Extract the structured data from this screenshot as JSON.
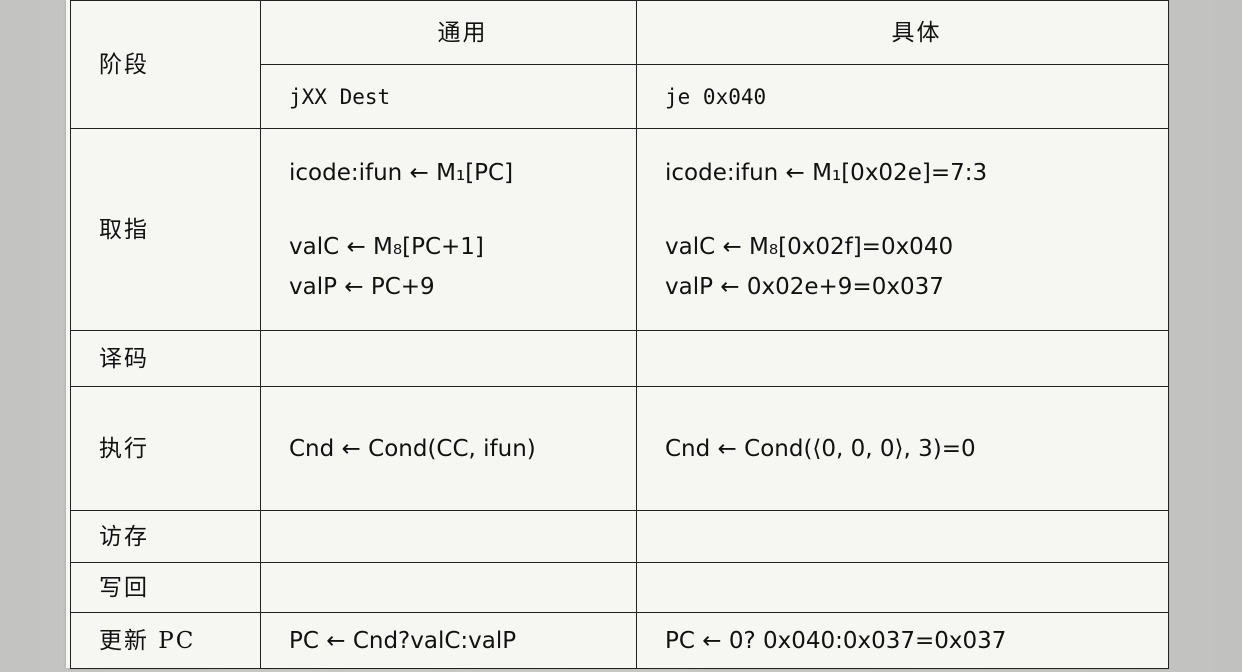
{
  "header": {
    "stage_label": "阶段",
    "general_label": "通用",
    "specific_label": "具体",
    "general_instr": "jXX Dest",
    "specific_instr": "je 0x040"
  },
  "rows": {
    "fetch": {
      "stage": "取指",
      "general": [
        "icode:ifun ← M₁[PC]",
        "valC ← M₈[PC+1]",
        "valP ← PC+9"
      ],
      "specific": [
        "icode:ifun ← M₁[0x02e]=7:3",
        "valC ← M₈[0x02f]=0x040",
        "valP ← 0x02e+9=0x037"
      ]
    },
    "decode": {
      "stage": "译码"
    },
    "execute": {
      "stage": "执行",
      "general": "Cnd ← Cond(CC, ifun)",
      "specific": "Cnd ← Cond(⟨0, 0, 0⟩, 3)=0"
    },
    "memory": {
      "stage": "访存"
    },
    "writeback": {
      "stage": "写回"
    },
    "update_pc": {
      "stage": "更新 PC",
      "general": "PC ← Cnd?valC:valP",
      "specific": "PC ← 0? 0x040:0x037=0x037"
    }
  }
}
